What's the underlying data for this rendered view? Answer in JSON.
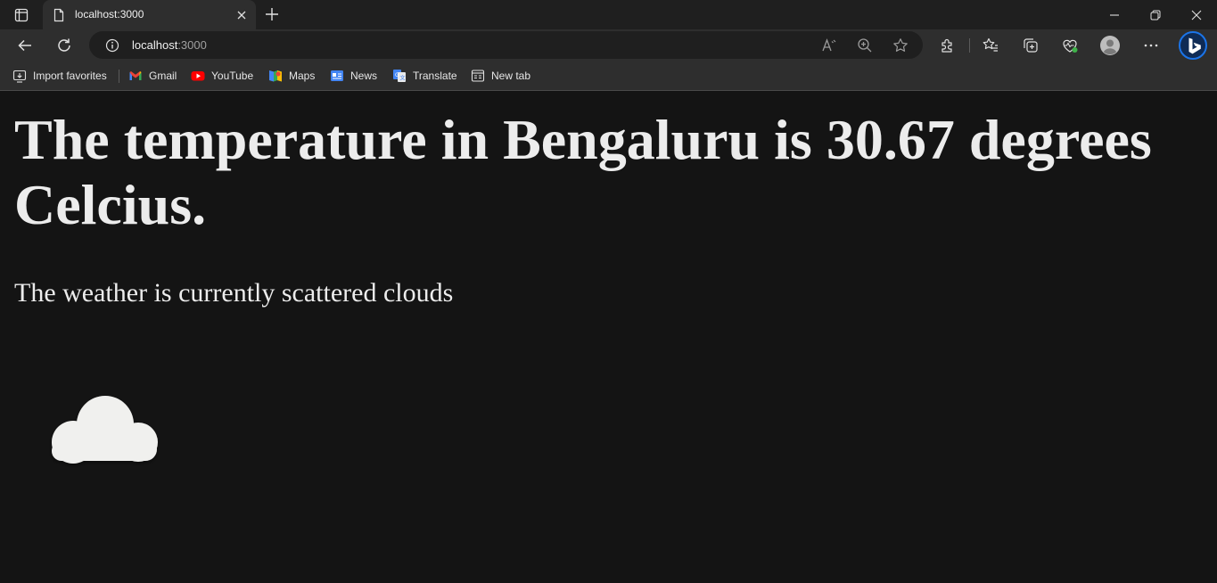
{
  "browser": {
    "tab": {
      "title": "localhost:3000"
    },
    "address_bar": {
      "host": "localhost",
      "port": ":3000"
    },
    "bookmarks": [
      {
        "label": "Import favorites",
        "icon": "import-icon"
      },
      {
        "label": "Gmail",
        "icon": "gmail-icon"
      },
      {
        "label": "YouTube",
        "icon": "youtube-icon"
      },
      {
        "label": "Maps",
        "icon": "maps-icon"
      },
      {
        "label": "News",
        "icon": "news-icon"
      },
      {
        "label": "Translate",
        "icon": "translate-icon"
      },
      {
        "label": "New tab",
        "icon": "new-tab-icon"
      }
    ]
  },
  "page": {
    "headline": "The temperature in Bengaluru is 30.67 degrees Celcius.",
    "description": "The weather is currently scattered clouds",
    "weather_icon": "scattered-clouds-icon"
  },
  "colors": {
    "page_background": "#141414",
    "text": "#ececec",
    "chrome_dark": "#1f1f1f",
    "chrome": "#2e2e2e",
    "bing_accent": "#1b74e8"
  }
}
